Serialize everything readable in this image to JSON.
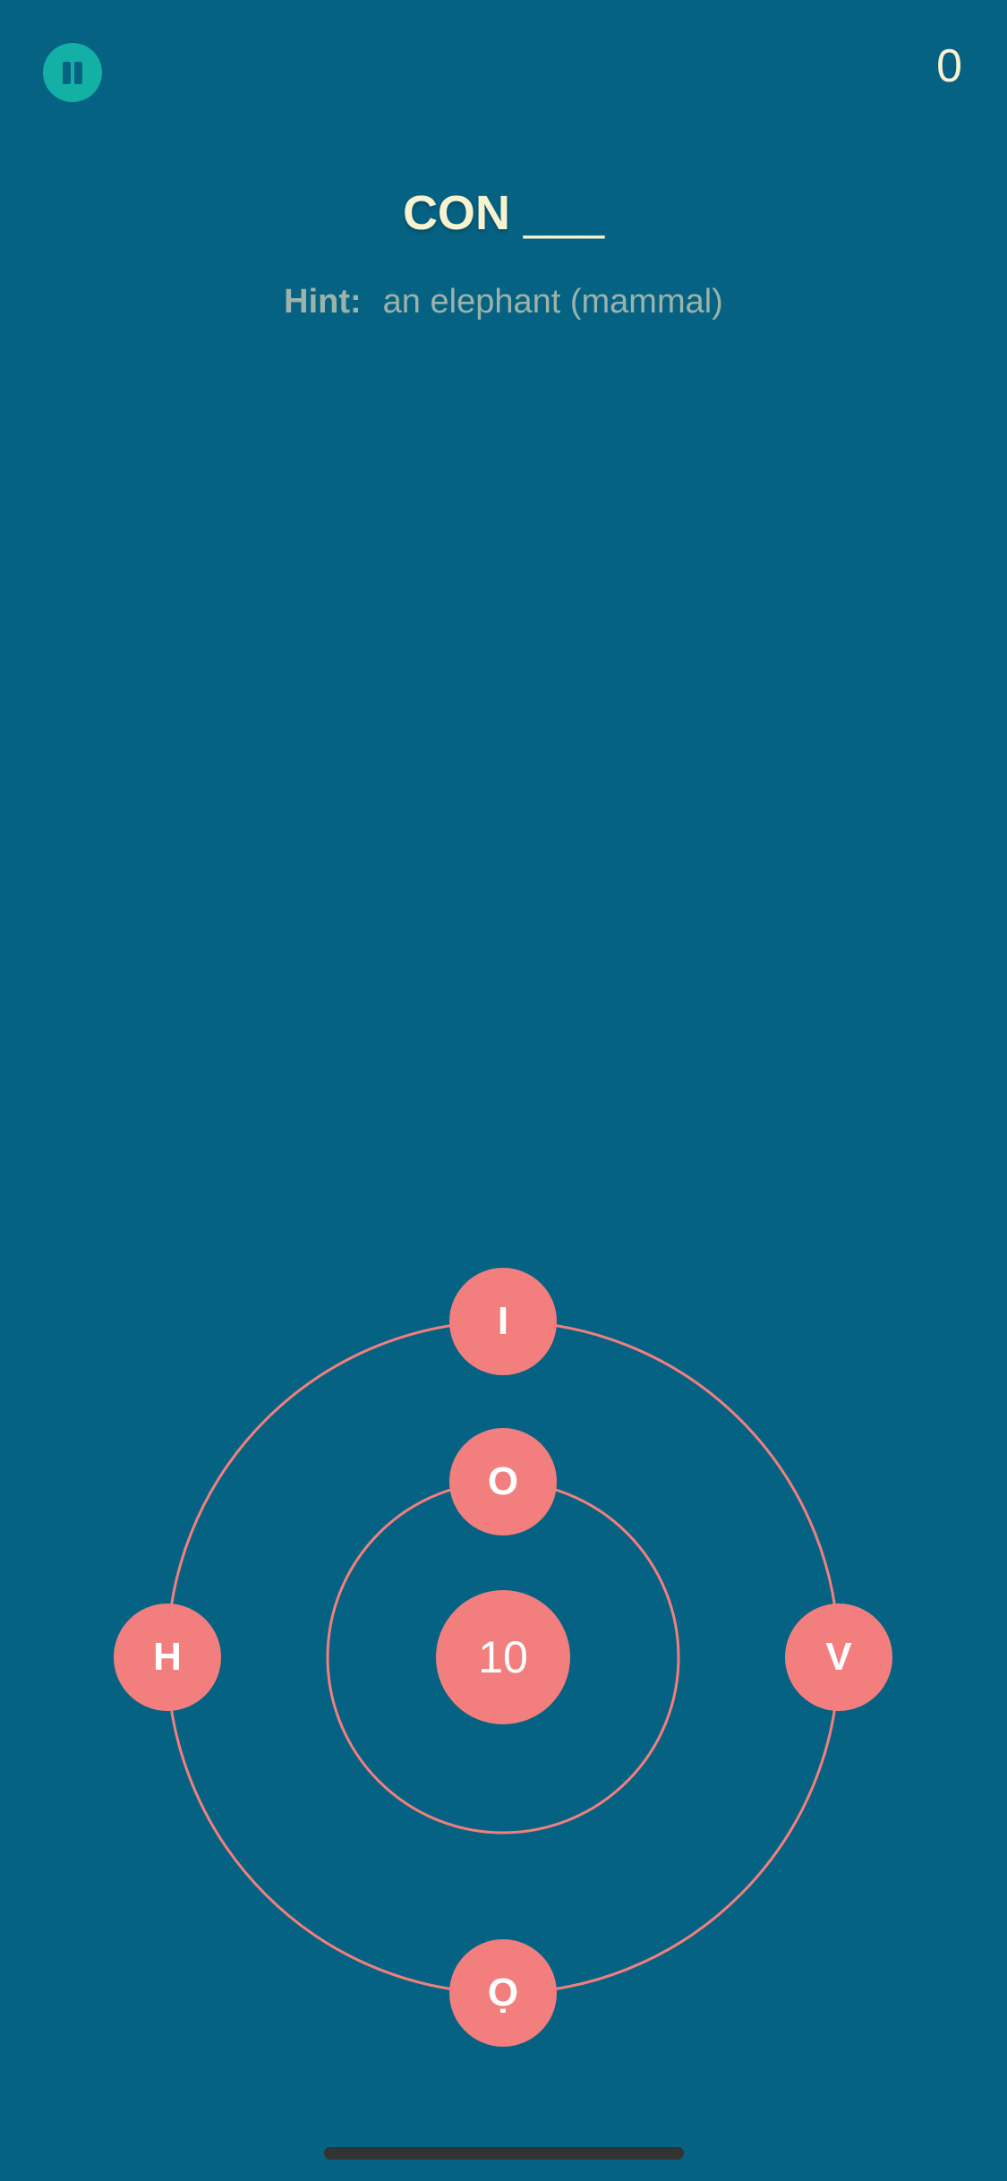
{
  "colors": {
    "background": "#066283",
    "accent_teal": "#13b0a5",
    "node_coral": "#f27f7e",
    "title_cream": "#f7f2cf",
    "hint_gray": "#9ab3ab"
  },
  "header": {
    "pause_icon": "pause-icon",
    "score": "0"
  },
  "puzzle": {
    "letters": "CON",
    "blanks": " ___",
    "hint_label": "Hint:",
    "hint_text": "an elephant (mammal)"
  },
  "wheel": {
    "center_value": "10",
    "inner_ring": [
      "O"
    ],
    "outer_ring": [
      "I",
      "V",
      "Ọ",
      "H"
    ]
  }
}
